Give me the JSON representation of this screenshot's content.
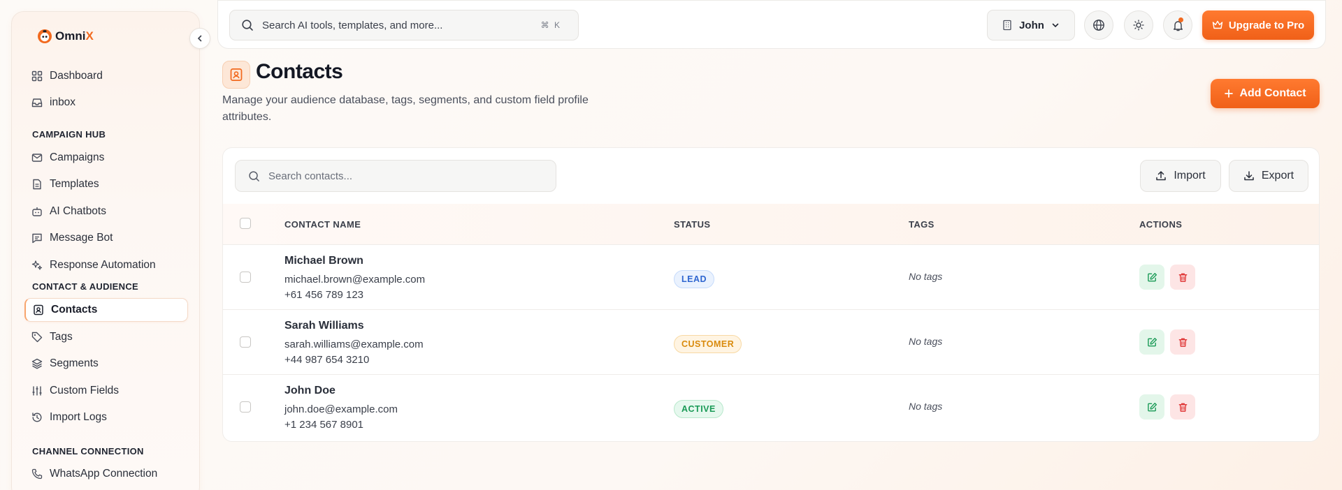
{
  "colors": {
    "accent": "#f26a1f",
    "lead": "#2f66d0",
    "customer": "#d98a0c",
    "active": "#1a9a56",
    "danger": "#e03a3a"
  },
  "app": {
    "logo_prefix": "Omni",
    "logo_suffix": "X"
  },
  "sidebar": {
    "top_items": [
      {
        "label": "Dashboard",
        "icon": "grid-icon"
      },
      {
        "label": "inbox",
        "icon": "inbox-icon"
      }
    ],
    "sections": [
      {
        "title": "CAMPAIGN HUB",
        "items": [
          {
            "label": "Campaigns",
            "icon": "mail-icon"
          },
          {
            "label": "Templates",
            "icon": "file-icon"
          },
          {
            "label": "AI Chatbots",
            "icon": "bot-icon"
          },
          {
            "label": "Message Bot",
            "icon": "message-icon"
          },
          {
            "label": "Response Automation",
            "icon": "sparkles-icon"
          }
        ]
      },
      {
        "title": "CONTACT & AUDIENCE",
        "items": [
          {
            "label": "Contacts",
            "icon": "contact-icon",
            "active": true
          },
          {
            "label": "Tags",
            "icon": "tag-icon"
          },
          {
            "label": "Segments",
            "icon": "layers-icon"
          },
          {
            "label": "Custom Fields",
            "icon": "sliders-icon"
          },
          {
            "label": "Import Logs",
            "icon": "history-icon"
          }
        ]
      },
      {
        "title": "CHANNEL CONNECTION",
        "items": [
          {
            "label": "WhatsApp Connection",
            "icon": "phone-icon"
          }
        ]
      }
    ]
  },
  "topbar": {
    "search_placeholder": "Search AI tools, templates, and more...",
    "shortcut": "⌘ K",
    "user_name": "John",
    "upgrade_label": "Upgrade to Pro"
  },
  "page": {
    "title": "Contacts",
    "subtitle": "Manage your audience database, tags, segments, and custom field profile attributes.",
    "add_label": "Add Contact"
  },
  "table": {
    "search_placeholder": "Search contacts...",
    "import_label": "Import",
    "export_label": "Export",
    "columns": {
      "name": "CONTACT NAME",
      "status": "STATUS",
      "tags": "TAGS",
      "actions": "ACTIONS"
    },
    "rows": [
      {
        "name": "Michael Brown",
        "email": "michael.brown@example.com",
        "phone": "+61 456 789 123",
        "status": "LEAD",
        "status_type": "lead",
        "tags": "No tags"
      },
      {
        "name": "Sarah Williams",
        "email": "sarah.williams@example.com",
        "phone": "+44 987 654 3210",
        "status": "CUSTOMER",
        "status_type": "customer",
        "tags": "No tags"
      },
      {
        "name": "John Doe",
        "email": "john.doe@example.com",
        "phone": "+1 234 567 8901",
        "status": "ACTIVE",
        "status_type": "active",
        "tags": "No tags"
      }
    ]
  }
}
